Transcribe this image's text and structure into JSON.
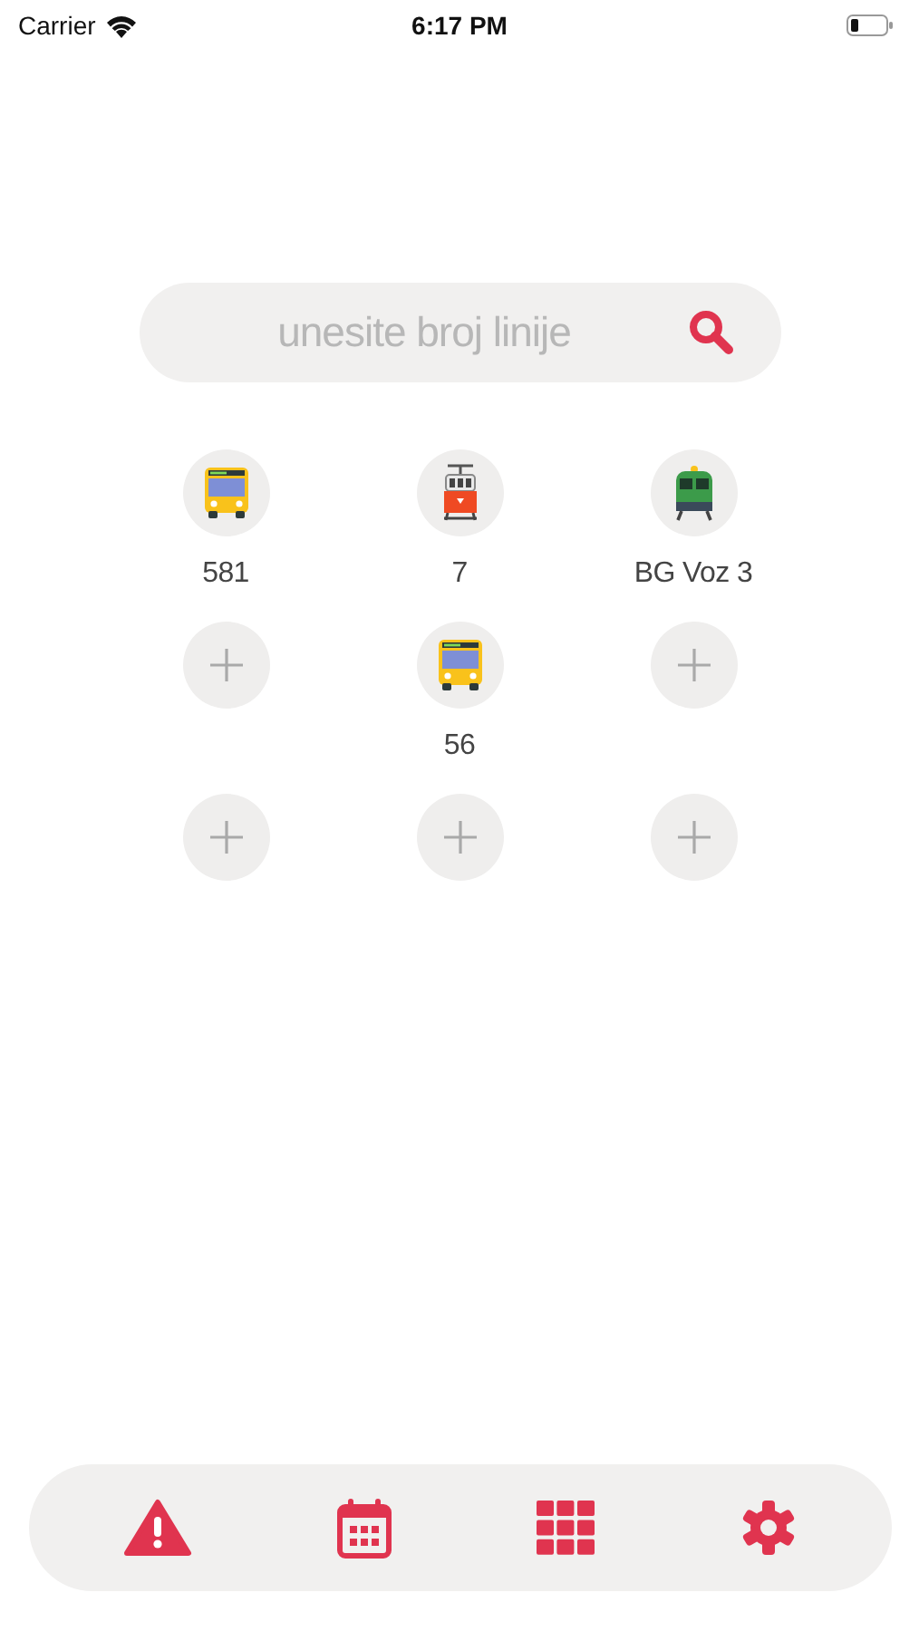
{
  "status_bar": {
    "carrier": "Carrier",
    "time": "6:17 PM"
  },
  "search": {
    "placeholder": "unesite broj linije"
  },
  "favorites": [
    {
      "kind": "bus",
      "label": "581"
    },
    {
      "kind": "tram",
      "label": "7"
    },
    {
      "kind": "train",
      "label": "BG Voz 3"
    },
    {
      "kind": "empty"
    },
    {
      "kind": "bus",
      "label": "56"
    },
    {
      "kind": "empty"
    },
    {
      "kind": "empty"
    },
    {
      "kind": "empty"
    },
    {
      "kind": "empty"
    }
  ],
  "tab_bar": [
    {
      "kind": "warning"
    },
    {
      "kind": "calendar"
    },
    {
      "kind": "grid"
    },
    {
      "kind": "settings"
    }
  ]
}
